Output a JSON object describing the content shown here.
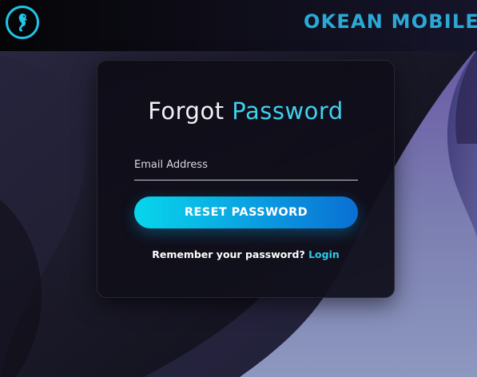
{
  "header": {
    "brand": "OKEAN MOBILE",
    "logo_icon": "seahorse-icon",
    "accent_color": "#1fc6e6"
  },
  "form": {
    "title_part1": "Forgot",
    "title_part2": "Password",
    "email_label": "Email Address",
    "submit_label": "RESET PASSWORD",
    "remember_text": "Remember your password?",
    "login_label": "Login"
  },
  "colors": {
    "accent": "#3fd0ee",
    "button_start": "#08d6ec",
    "button_end": "#0a6fd3",
    "card_bg": "#0f0e1a"
  }
}
